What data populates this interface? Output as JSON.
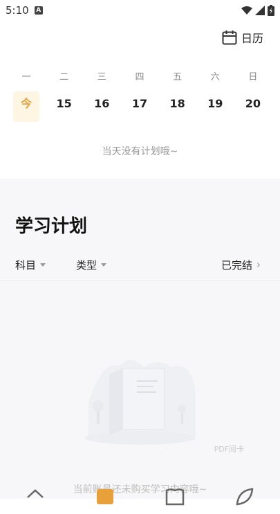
{
  "status_bar": {
    "time": "5:10",
    "badge": "A"
  },
  "header": {
    "calendar_label": "日历"
  },
  "week": {
    "days": [
      "一",
      "二",
      "三",
      "四",
      "五",
      "六",
      "日"
    ],
    "dates": [
      "今",
      "15",
      "16",
      "17",
      "18",
      "19",
      "20"
    ]
  },
  "day_empty_text": "当天没有计划哦~",
  "plan": {
    "title": "学习计划",
    "filters": {
      "subject": "科目",
      "type": "类型",
      "completed": "已完结"
    },
    "empty_text": "当前账号还未购买学习内容哦~",
    "watermark": "PDF阅卡"
  },
  "colors": {
    "accent": "#e8a13a",
    "today_bg": "#fff5e3",
    "section_bg": "#f7f7f9"
  }
}
